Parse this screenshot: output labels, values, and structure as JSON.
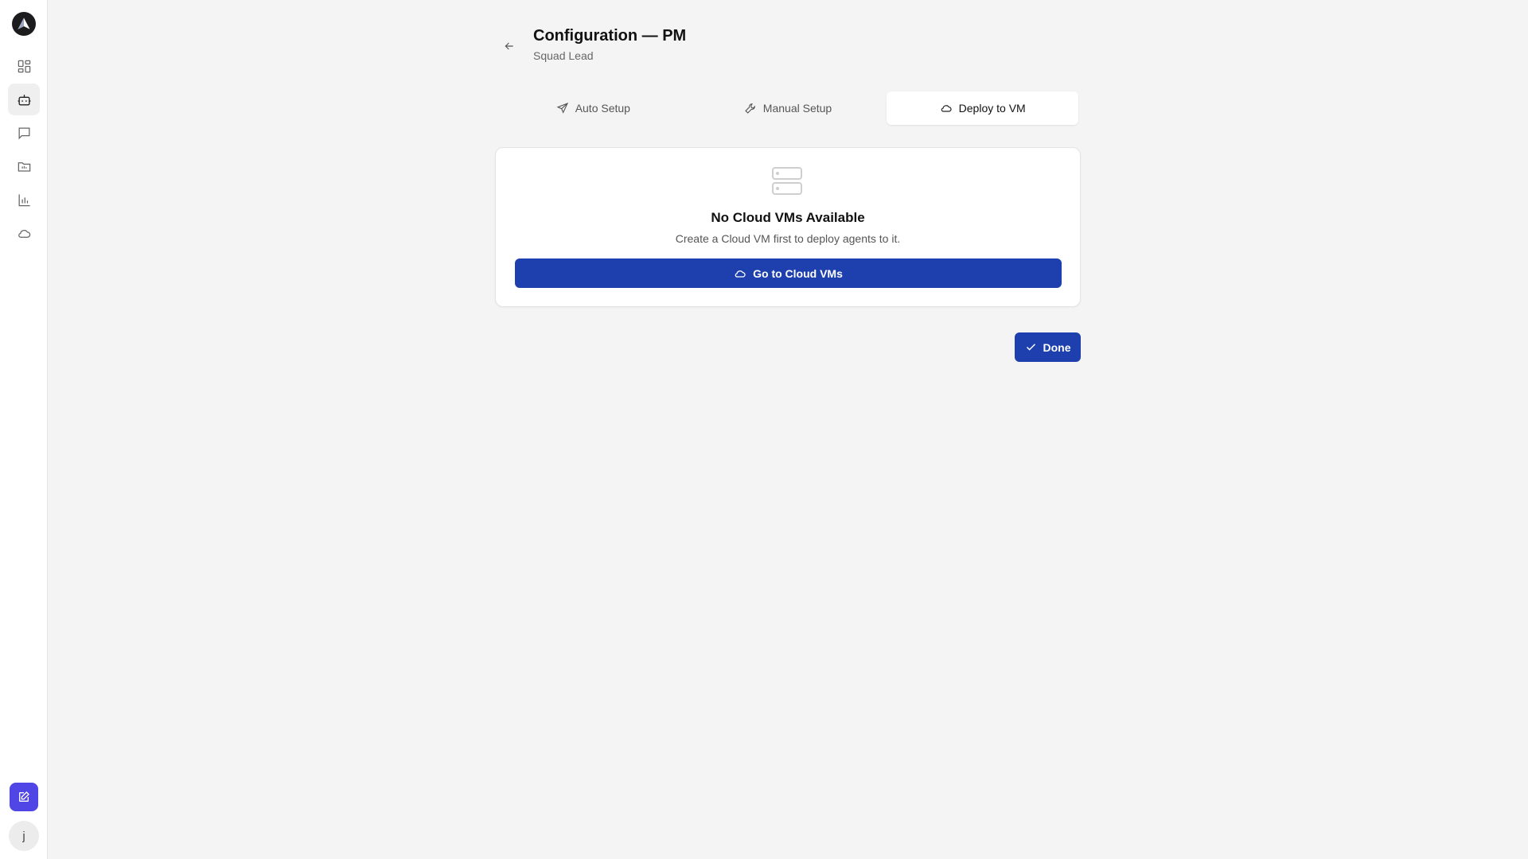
{
  "sidebar": {
    "nav": [
      {
        "name": "dashboard",
        "icon": "dashboard-icon",
        "active": false
      },
      {
        "name": "agents",
        "icon": "robot-icon",
        "active": true
      },
      {
        "name": "chat",
        "icon": "message-icon",
        "active": false
      },
      {
        "name": "projects",
        "icon": "folder-icon",
        "active": false
      },
      {
        "name": "analytics",
        "icon": "bar-chart-icon",
        "active": false
      },
      {
        "name": "cloud",
        "icon": "cloud-icon",
        "active": false
      }
    ],
    "compose_icon": "edit-icon",
    "avatar_initial": "j"
  },
  "header": {
    "title": "Configuration — PM",
    "subtitle": "Squad Lead"
  },
  "tabs": [
    {
      "label": "Auto Setup",
      "icon": "send-icon",
      "active": false
    },
    {
      "label": "Manual Setup",
      "icon": "wrench-icon",
      "active": false
    },
    {
      "label": "Deploy to VM",
      "icon": "cloud-icon",
      "active": true
    }
  ],
  "empty_state": {
    "icon": "server-icon",
    "title": "No Cloud VMs Available",
    "description": "Create a Cloud VM first to deploy agents to it.",
    "button_label": "Go to Cloud VMs"
  },
  "footer": {
    "done_label": "Done"
  },
  "colors": {
    "primary": "#1e40af",
    "compose": "#4f46e5",
    "background": "#f4f4f4"
  }
}
